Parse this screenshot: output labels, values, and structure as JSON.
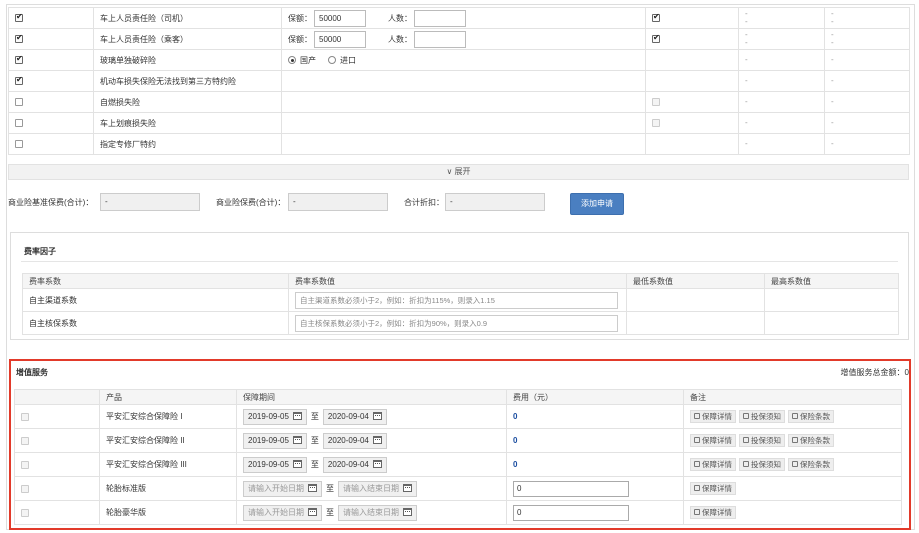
{
  "coverage_rows": [
    {
      "checked": true,
      "name": "车上人员责任险（司机）",
      "detail": {
        "type": "amount",
        "amount_label": "保额：",
        "amount_value": "50000",
        "count_label": "人数：",
        "count_value": ""
      },
      "extra_checked": true,
      "col5": [
        "-",
        "-"
      ],
      "col6": [
        "-",
        "-"
      ]
    },
    {
      "checked": true,
      "name": "车上人员责任险（乘客）",
      "detail": {
        "type": "amount",
        "amount_label": "保额：",
        "amount_value": "50000",
        "count_label": "人数：",
        "count_value": ""
      },
      "extra_checked": true,
      "col5": [
        "-",
        "-"
      ],
      "col6": [
        "-",
        "-"
      ]
    },
    {
      "checked": true,
      "name": "玻璃单独破碎险",
      "detail": {
        "type": "radio",
        "options": [
          "国产",
          "进口"
        ],
        "selected": 0
      },
      "extra_checked": null,
      "col5": [
        "-"
      ],
      "col6": [
        "-"
      ]
    },
    {
      "checked": true,
      "name": "机动车损失保险无法找到第三方特约险",
      "detail": {
        "type": "none"
      },
      "extra_checked": null,
      "col5": [
        "-"
      ],
      "col6": [
        "-"
      ]
    },
    {
      "checked": false,
      "name": "自燃损失险",
      "detail": {
        "type": "none"
      },
      "extra_checked": false,
      "col5": [
        "-"
      ],
      "col6": [
        "-"
      ]
    },
    {
      "checked": false,
      "name": "车上划痕损失险",
      "detail": {
        "type": "none"
      },
      "extra_checked": false,
      "col5": [
        "-"
      ],
      "col6": [
        "-"
      ]
    },
    {
      "checked": false,
      "name": "指定专修厂特约",
      "detail": {
        "type": "none"
      },
      "extra_checked": null,
      "col5": [
        "-"
      ],
      "col6": [
        "-"
      ]
    }
  ],
  "expand_label": "∨ 展开",
  "totals": {
    "premium_label": "商业险基准保费(合计)：",
    "premium_value": "-",
    "paid_label": "商业险保费(合计)：",
    "paid_value": "-",
    "discount_label": "合计折扣：",
    "discount_value": "-",
    "apply_button": "添加申请"
  },
  "rate_factors": {
    "title": "费率因子",
    "headers": [
      "费率系数",
      "费率系数值",
      "最低系数值",
      "最高系数值"
    ],
    "rows": [
      {
        "name": "自主渠道系数",
        "hint": "自主渠道系数必须小于2，例如：折扣为115%，则录入1.15"
      },
      {
        "name": "自主核保系数",
        "hint": "自主核保系数必须小于2，例如：折扣为90%，则录入0.9"
      }
    ]
  },
  "value_added": {
    "title": "增值服务",
    "total_label": "增值服务总金额：0",
    "headers": [
      "产品",
      "保障期间",
      "费用（元）",
      "备注"
    ],
    "to_label": "至",
    "rows": [
      {
        "product": "平安汇安综合保障险 I",
        "start": "2019-09-05",
        "end": "2020-09-04",
        "start_placeholder": false,
        "fee": "0",
        "fee_editable": false,
        "tags": [
          "保障详情",
          "投保须知",
          "保险条款"
        ]
      },
      {
        "product": "平安汇安综合保障险 II",
        "start": "2019-09-05",
        "end": "2020-09-04",
        "start_placeholder": false,
        "fee": "0",
        "fee_editable": false,
        "tags": [
          "保障详情",
          "投保须知",
          "保险条款"
        ]
      },
      {
        "product": "平安汇安综合保障险 III",
        "start": "2019-09-05",
        "end": "2020-09-04",
        "start_placeholder": false,
        "fee": "0",
        "fee_editable": false,
        "tags": [
          "保障详情",
          "投保须知",
          "保险条款"
        ]
      },
      {
        "product": "轮胎标准版",
        "start": "请输入开始日期",
        "end": "请输入结束日期",
        "start_placeholder": true,
        "fee": "0",
        "fee_editable": true,
        "tags": [
          "保障详情"
        ]
      },
      {
        "product": "轮胎豪华版",
        "start": "请输入开始日期",
        "end": "请输入结束日期",
        "start_placeholder": true,
        "fee": "0",
        "fee_editable": true,
        "tags": [
          "保障详情"
        ]
      }
    ]
  }
}
